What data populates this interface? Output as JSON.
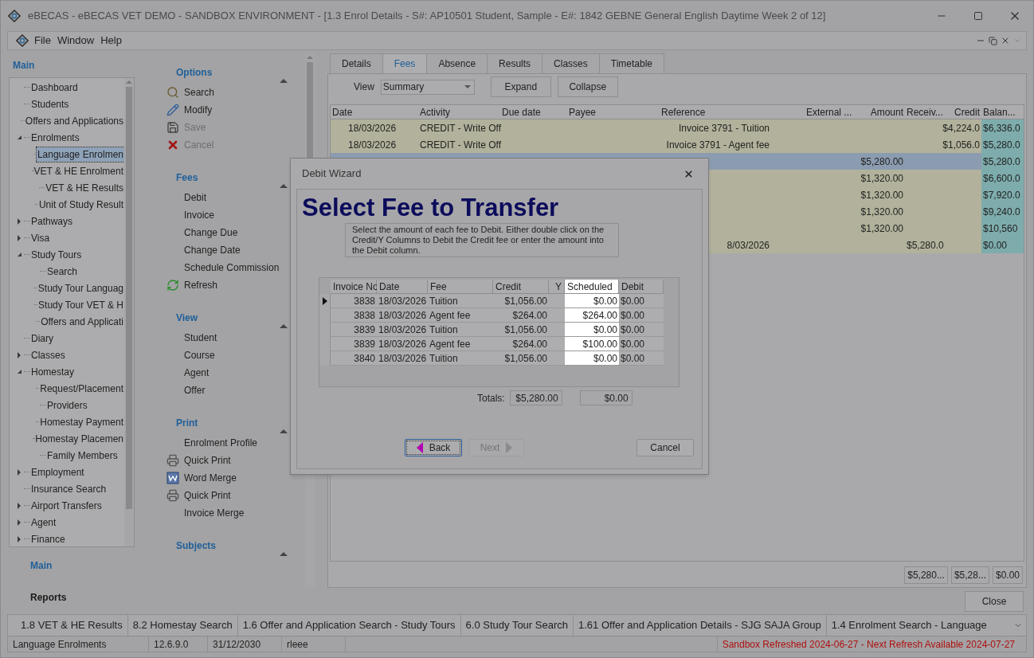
{
  "window": {
    "title": "eBECAS - eBECAS VET DEMO - SANDBOX ENVIRONMENT - [1.3 Enrol Details - S#: AP10501 Student, Sample - E#: 1842 GEBNE General English Daytime Week 2 of 12]"
  },
  "menu": [
    "File",
    "Window",
    "Help"
  ],
  "nav": {
    "title": "Main",
    "tree": [
      {
        "label": "Dashboard",
        "selected": false,
        "kind": "leaf"
      },
      {
        "label": "Students",
        "selected": false,
        "kind": "leaf"
      },
      {
        "label": "Offers and Applications",
        "selected": false,
        "kind": "leaf"
      },
      {
        "label": "Enrolments",
        "selected": false,
        "kind": "expanded",
        "children": [
          {
            "label": "Language Enrolmen",
            "selected": true
          },
          {
            "label": "VET & HE Enrolment",
            "selected": false
          },
          {
            "label": "VET & HE Results",
            "selected": false
          },
          {
            "label": "Unit of Study Result",
            "selected": false
          }
        ]
      },
      {
        "label": "Pathways",
        "selected": false,
        "kind": "collapsed"
      },
      {
        "label": "Visa",
        "selected": false,
        "kind": "collapsed"
      },
      {
        "label": "Study Tours",
        "selected": false,
        "kind": "expanded",
        "children": [
          {
            "label": "Search",
            "selected": false
          },
          {
            "label": "Study Tour Languag",
            "selected": false
          },
          {
            "label": "Study Tour VET & H",
            "selected": false
          },
          {
            "label": "Offers and Applicati",
            "selected": false
          }
        ]
      },
      {
        "label": "Diary",
        "selected": false,
        "kind": "leaf"
      },
      {
        "label": "Classes",
        "selected": false,
        "kind": "collapsed"
      },
      {
        "label": "Homestay",
        "selected": false,
        "kind": "expanded",
        "children": [
          {
            "label": "Request/Placement",
            "selected": false
          },
          {
            "label": "Providers",
            "selected": false
          },
          {
            "label": "Homestay Payment",
            "selected": false
          },
          {
            "label": "Homestay Placemen",
            "selected": false
          },
          {
            "label": "Family Members",
            "selected": false
          }
        ]
      },
      {
        "label": "Employment",
        "selected": false,
        "kind": "collapsed"
      },
      {
        "label": "Insurance Search",
        "selected": false,
        "kind": "leaf"
      },
      {
        "label": "Airport Transfers",
        "selected": false,
        "kind": "collapsed"
      },
      {
        "label": "Agent",
        "selected": false,
        "kind": "collapsed"
      },
      {
        "label": "Finance",
        "selected": false,
        "kind": "collapsed"
      }
    ],
    "buttons": [
      {
        "label": "Main",
        "selected": true
      },
      {
        "label": "Reports",
        "selected": false
      }
    ]
  },
  "actions": [
    {
      "title": "Options",
      "items": [
        {
          "label": "Search",
          "kind": "search",
          "disabled": false
        },
        {
          "label": "Modify",
          "kind": "edit",
          "disabled": false
        },
        {
          "label": "Save",
          "kind": "save",
          "disabled": true
        },
        {
          "label": "Cancel",
          "kind": "cancel",
          "disabled": true
        }
      ]
    },
    {
      "title": "Fees",
      "items": [
        {
          "label": "Debit",
          "kind": "plain",
          "disabled": false
        },
        {
          "label": "Invoice",
          "kind": "plain",
          "disabled": false
        },
        {
          "label": "Change Due",
          "kind": "plain",
          "disabled": false
        },
        {
          "label": "Change Date",
          "kind": "plain",
          "disabled": false
        },
        {
          "label": "Schedule Commission",
          "kind": "plain",
          "disabled": false
        },
        {
          "label": "Refresh",
          "kind": "refresh",
          "disabled": false
        }
      ]
    },
    {
      "title": "View",
      "items": [
        {
          "label": "Student",
          "kind": "plain",
          "disabled": false
        },
        {
          "label": "Course",
          "kind": "plain",
          "disabled": false
        },
        {
          "label": "Agent",
          "kind": "plain",
          "disabled": false
        },
        {
          "label": "Offer",
          "kind": "plain",
          "disabled": false
        }
      ]
    },
    {
      "title": "Print",
      "items": [
        {
          "label": "Enrolment Profile",
          "kind": "plain",
          "disabled": false
        },
        {
          "label": "Quick Print",
          "kind": "print",
          "disabled": false
        },
        {
          "label": "Word Merge",
          "kind": "word",
          "disabled": false
        },
        {
          "label": "Quick Print",
          "kind": "print",
          "disabled": false
        },
        {
          "label": "Invoice Merge",
          "kind": "plain",
          "disabled": false
        }
      ]
    },
    {
      "title": "Subjects"
    }
  ],
  "tabs": [
    {
      "label": "Details",
      "selected": false
    },
    {
      "label": "Fees",
      "selected": true
    },
    {
      "label": "Absence",
      "selected": false
    },
    {
      "label": "Results",
      "selected": false
    },
    {
      "label": "Classes",
      "selected": false
    },
    {
      "label": "Timetable",
      "selected": false
    }
  ],
  "fees": {
    "view_label": "View",
    "view_value": "Summary",
    "buttons": [
      "Expand",
      "Collapse"
    ],
    "columns": [
      "Date",
      "Activity",
      "Due date",
      "Payee",
      "Reference",
      "External ...",
      "Amount",
      "Receiv...",
      "Credit",
      "Balan..."
    ],
    "rows": [
      {
        "selected": false,
        "cells": {
          "date": "18/03/2026",
          "activity": "CREDIT - Write Off",
          "reference": "Invoice 3791 - Tuition",
          "credit": "$4,224.0",
          "balance": "$6,336.0"
        }
      },
      {
        "selected": false,
        "cells": {
          "date": "18/03/2026",
          "activity": "CREDIT - Write Off",
          "reference": "Invoice 3791 - Agent fee",
          "credit": "$1,056.0",
          "balance": "$5,280.0"
        }
      },
      {
        "selected": true,
        "cells": {
          "amount": "$5,280.00",
          "balance": "$5,280.0"
        }
      },
      {
        "selected": false,
        "cells": {
          "amount": "$1,320.00",
          "balance": "$6,600.0"
        }
      },
      {
        "selected": false,
        "cells": {
          "amount": "$1,320.00",
          "balance": "$7,920.0"
        }
      },
      {
        "selected": false,
        "cells": {
          "amount": "$1,320.00",
          "balance": "$9,240.0"
        }
      },
      {
        "selected": false,
        "cells": {
          "amount": "$1,320.00",
          "balance": "$10,560"
        }
      },
      {
        "selected": false,
        "cells": {
          "reference": "8/03/2026",
          "receivable": "$5,280.0",
          "balance": "$0.00"
        }
      }
    ],
    "totals": [
      "$5,280...",
      "$5,28...",
      "$0.00"
    ],
    "close": "Close"
  },
  "dialog": {
    "title": "Debit Wizard",
    "heading": "Select Fee to Transfer",
    "instructions": "Select the amount of each fee to Debit.  Either double click on the Credit/Y Columns to Debit the Credit fee or enter the amount into the Debit column.",
    "columns": [
      "Invoice No",
      "Date",
      "Fee",
      "Credit",
      "Y",
      "Scheduled",
      "Debit"
    ],
    "rows": [
      {
        "current": true,
        "invoice": "3838",
        "date": "18/03/2026",
        "fee": "Tuition",
        "credit": "$1,056.00",
        "scheduled": "$0.00",
        "debit": "$0.00"
      },
      {
        "current": false,
        "invoice": "3838",
        "date": "18/03/2026",
        "fee": "Agent fee",
        "credit": "$264.00",
        "scheduled": "$264.00",
        "debit": "$0.00"
      },
      {
        "current": false,
        "invoice": "3839",
        "date": "18/03/2026",
        "fee": "Tuition",
        "credit": "$1,056.00",
        "scheduled": "$0.00",
        "debit": "$0.00"
      },
      {
        "current": false,
        "invoice": "3839",
        "date": "18/03/2026",
        "fee": "Agent fee",
        "credit": "$264.00",
        "scheduled": "$100.00",
        "debit": "$0.00"
      },
      {
        "current": false,
        "invoice": "3840",
        "date": "18/03/2026",
        "fee": "Tuition",
        "credit": "$1,056.00",
        "scheduled": "$0.00",
        "debit": "$0.00"
      }
    ],
    "totals_label": "Totals:",
    "totals": [
      "$5,280.00",
      "$0.00"
    ],
    "back": {
      "label": "Back",
      "disabled": false
    },
    "next": {
      "label": "Next",
      "disabled": true
    },
    "cancel": {
      "label": "Cancel",
      "disabled": false
    }
  },
  "taskbar": [
    "1.8 VET & HE Results",
    "8.2 Homestay Search",
    "1.6 Offer and Application Search - Study Tours",
    "6.0 Study Tour Search",
    "1.61 Offer and Application Details - SJG SAJA Group",
    "1.4 Enrolment Search - Language"
  ],
  "status_bar": {
    "fields": [
      "Language Enrolments",
      "12.6.9.0",
      "31/12/2030",
      "rleee"
    ],
    "notice": "Sandbox Refreshed 2024-06-27 - Next Refresh Available 2024-07-27"
  }
}
